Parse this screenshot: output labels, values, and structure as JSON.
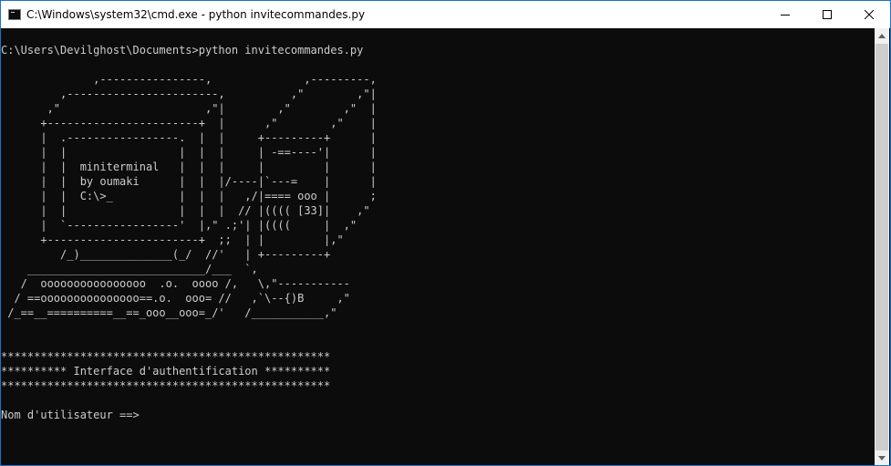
{
  "window": {
    "title": "C:\\Windows\\system32\\cmd.exe - python  invitecommandes.py",
    "icon": "console-app-icon",
    "controls": {
      "minimize": "minimize-icon",
      "maximize": "maximize-icon",
      "close": "close-icon"
    }
  },
  "console": {
    "lines": [
      "C:\\Users\\Devilghost\\Documents>python invitecommandes.py",
      "",
      "              ,----------------,              ,---------,",
      "         ,-----------------------,          ,\"        ,\"|",
      "       ,\"                      ,\"|        ,\"        ,\"  |",
      "      +-----------------------+  |      ,\"        ,\"    |",
      "      |  .-----------------.  |  |     +---------+      |",
      "      |  |                 |  |  |     | -==----'|      |",
      "      |  |  miniterminal   |  |  |     |         |      |",
      "      |  |  by oumaki      |  |  |/----|`---=    |      |",
      "      |  |  C:\\>_          |  |  |   ,/|==== ooo |      ;",
      "      |  |                 |  |  |  // |(((( [33]|    ,\"",
      "      |  `-----------------'  |,\" .;'| |((((     |  ,\"",
      "      +-----------------------+  ;;  | |         |,\"",
      "         /_)______________(_/  //'   | +---------+",
      "    ___________________________/___  `,",
      "   /  oooooooooooooooo  .o.  oooo /,   \\,\"-----------",
      "  / ==ooooooooooooooo==.o.  ooo= //   ,`\\--{)B     ,\"",
      " /_==__==========__==_ooo__ooo=_/'   /___________,\"",
      "",
      "",
      "**************************************************",
      "********** Interface d'authentification **********",
      "**************************************************",
      "",
      "Nom d'utilisateur ==>"
    ],
    "text_color": "#cccccc",
    "background": "#0c0c0c"
  },
  "scrollbar": {
    "up": "scroll-up-arrow-icon",
    "down": "scroll-down-arrow-icon"
  }
}
